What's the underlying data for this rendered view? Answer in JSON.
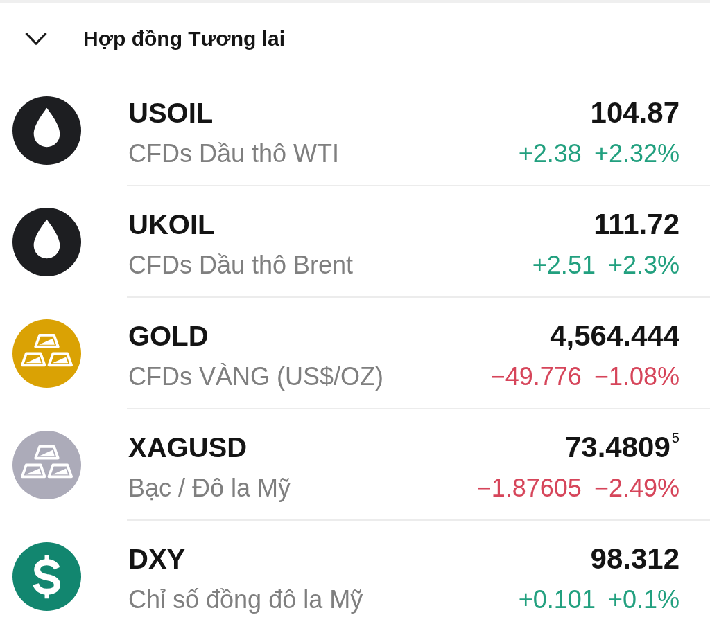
{
  "section": {
    "title": "Hợp đồng Tương lai",
    "expanded": true
  },
  "instruments": [
    {
      "symbol": "USOIL",
      "name": "CFDs Dầu thô WTI",
      "price": "104.87",
      "change": "+2.38",
      "change_percent": "+2.32%",
      "rising": true,
      "icon": {
        "kind": "drop",
        "color": "#1d1e21"
      }
    },
    {
      "symbol": "UKOIL",
      "name": "CFDs Dầu thô Brent",
      "price": "111.72",
      "change": "+2.51",
      "change_percent": "+2.3%",
      "rising": true,
      "icon": {
        "kind": "drop",
        "color": "#1d1e21"
      }
    },
    {
      "symbol": "GOLD",
      "name": "CFDs VÀNG (US$/OZ)",
      "price": "4,564.444",
      "change": "−49.776",
      "change_percent": "−1.08%",
      "rising": false,
      "icon": {
        "kind": "bars",
        "color": "#daa204"
      }
    },
    {
      "symbol": "XAGUSD",
      "name": "Bạc / Đô la Mỹ",
      "price": "73.4809$^{5}$",
      "change": "−1.87605",
      "change_percent": "−2.49%",
      "rising": false,
      "icon": {
        "kind": "bars",
        "color": "#acabb9"
      }
    },
    {
      "symbol": "DXY",
      "name": "Chỉ số đồng đô la Mỹ",
      "price": "98.312",
      "change": "+0.101",
      "change_percent": "+0.1%",
      "rising": true,
      "icon": {
        "kind": "dollar",
        "color": "#12866f"
      }
    }
  ]
}
